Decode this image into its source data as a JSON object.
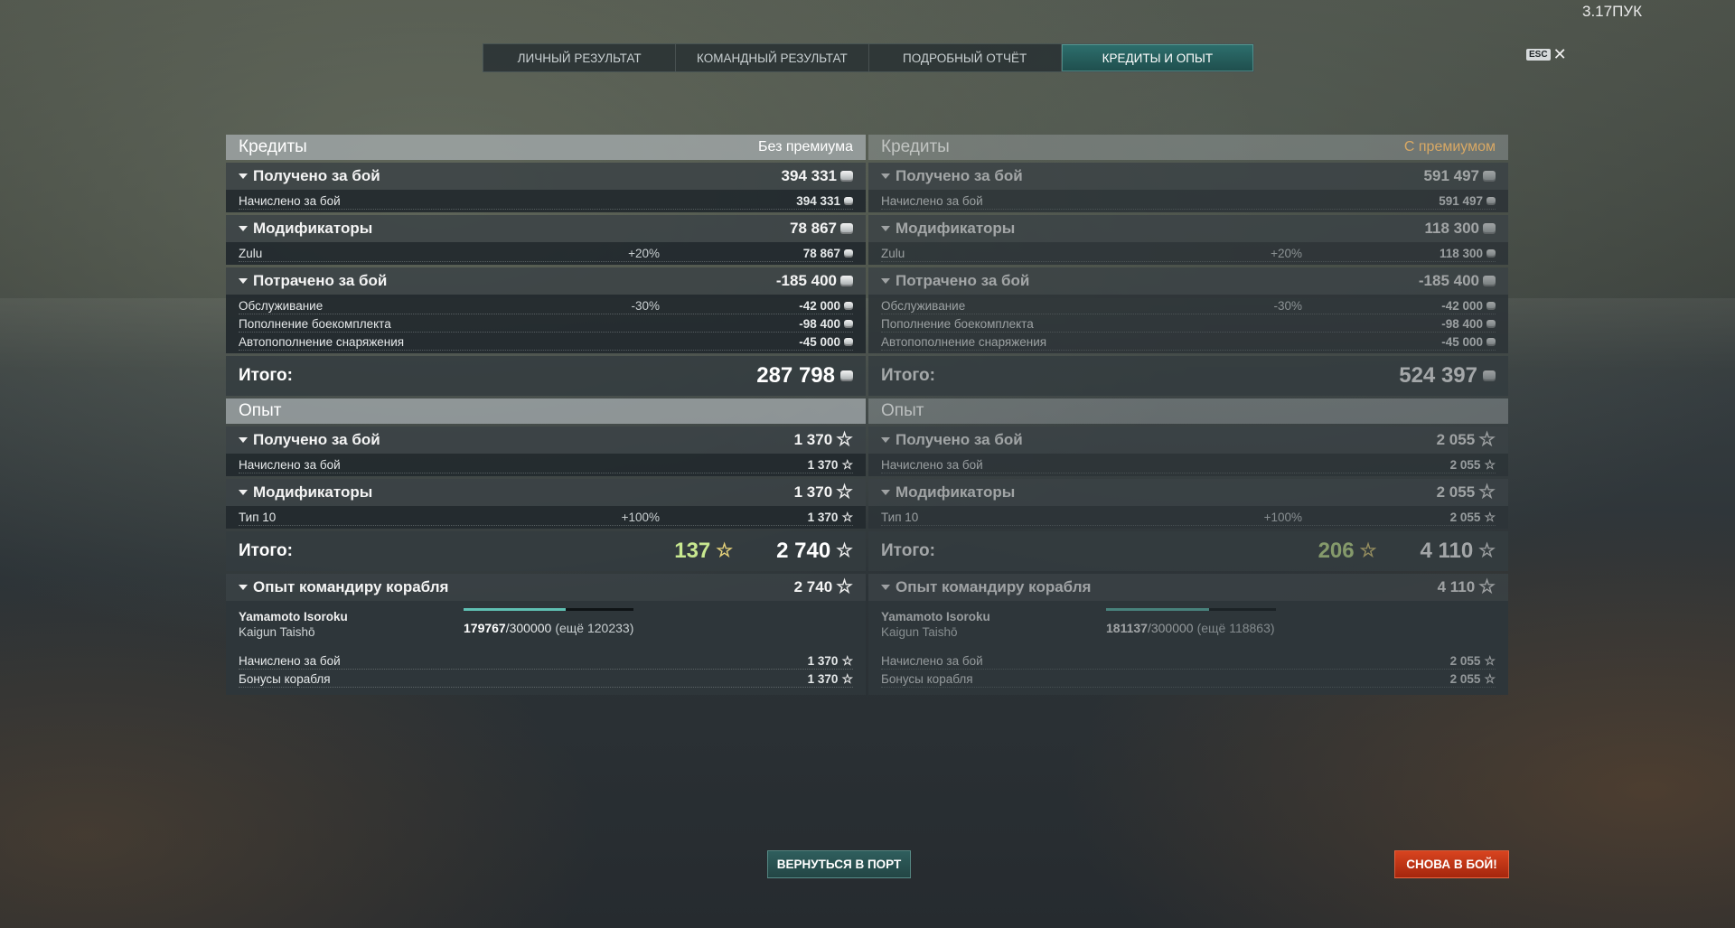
{
  "version": "3.17ПУК",
  "tabs": [
    "ЛИЧНЫЙ РЕЗУЛЬТАТ",
    "КОМАНДНЫЙ РЕЗУЛЬТАТ",
    "ПОДРОБНЫЙ ОТЧЁТ",
    "КРЕДИТЫ И ОПЫТ"
  ],
  "active_tab": "КРЕДИТЫ И ОПЫТ",
  "esc": {
    "key": "ESC",
    "close": "✕"
  },
  "icons": {
    "credit": "credit-coin-icon",
    "xp": "star-xp-icon",
    "collapse": "triangle-down-icon"
  },
  "colors": {
    "premium_label": "#d8a864",
    "free_xp": "#c8e890",
    "tab_active": "#2d6f6d",
    "battle_button": "#d8441f"
  },
  "left": {
    "credits_header": "Кредиты",
    "credits_note": "Без премиума",
    "earned": {
      "label": "Получено за бой",
      "value": "394 331",
      "rows": [
        {
          "name": "Начислено за бой",
          "value": "394 331"
        }
      ]
    },
    "modifiers": {
      "label": "Модификаторы",
      "value": "78 867",
      "rows": [
        {
          "name": "Zulu",
          "pct": "+20%",
          "value": "78 867"
        }
      ]
    },
    "spent": {
      "label": "Потрачено за бой",
      "value": "-185 400",
      "rows": [
        {
          "name": "Обслуживание",
          "pct": "-30%",
          "value": "-42 000"
        },
        {
          "name": "Пополнение боекомплекта",
          "pct": "",
          "value": "-98 400"
        },
        {
          "name": "Автопополнение снаряжения",
          "pct": "",
          "value": "-45 000"
        }
      ]
    },
    "credits_total": {
      "label": "Итого:",
      "value": "287 798"
    },
    "xp_header": "Опыт",
    "xp_earned": {
      "label": "Получено за бой",
      "value": "1 370",
      "rows": [
        {
          "name": "Начислено за бой",
          "value": "1 370"
        }
      ]
    },
    "xp_modifiers": {
      "label": "Модификаторы",
      "value": "1 370",
      "rows": [
        {
          "name": "Тип 10",
          "pct": "+100%",
          "value": "1 370"
        }
      ]
    },
    "xp_total": {
      "label": "Итого:",
      "free": "137",
      "value": "2 740"
    },
    "commander": {
      "label": "Опыт командиру корабля",
      "value": "2 740",
      "name": "Yamamoto Isoroku",
      "rank": "Kaigun Taishō",
      "xp_current": "179767",
      "xp_max": "/300000",
      "xp_left": "(ещё 120233)",
      "progress": 0.599,
      "rows": [
        {
          "name": "Начислено за бой",
          "value": "1 370"
        },
        {
          "name": "Бонусы корабля",
          "value": "1 370"
        }
      ]
    }
  },
  "right": {
    "credits_header": "Кредиты",
    "credits_note": "С премиумом",
    "earned": {
      "label": "Получено за бой",
      "value": "591 497",
      "rows": [
        {
          "name": "Начислено за бой",
          "value": "591 497"
        }
      ]
    },
    "modifiers": {
      "label": "Модификаторы",
      "value": "118 300",
      "rows": [
        {
          "name": "Zulu",
          "pct": "+20%",
          "value": "118 300"
        }
      ]
    },
    "spent": {
      "label": "Потрачено за бой",
      "value": "-185 400",
      "rows": [
        {
          "name": "Обслуживание",
          "pct": "-30%",
          "value": "-42 000"
        },
        {
          "name": "Пополнение боекомплекта",
          "pct": "",
          "value": "-98 400"
        },
        {
          "name": "Автопополнение снаряжения",
          "pct": "",
          "value": "-45 000"
        }
      ]
    },
    "credits_total": {
      "label": "Итого:",
      "value": "524 397"
    },
    "xp_header": "Опыт",
    "xp_earned": {
      "label": "Получено за бой",
      "value": "2 055",
      "rows": [
        {
          "name": "Начислено за бой",
          "value": "2 055"
        }
      ]
    },
    "xp_modifiers": {
      "label": "Модификаторы",
      "value": "2 055",
      "rows": [
        {
          "name": "Тип 10",
          "pct": "+100%",
          "value": "2 055"
        }
      ]
    },
    "xp_total": {
      "label": "Итого:",
      "free": "206",
      "value": "4 110"
    },
    "commander": {
      "label": "Опыт командиру корабля",
      "value": "4 110",
      "name": "Yamamoto Isoroku",
      "rank": "Kaigun Taishō",
      "xp_current": "181137",
      "xp_max": "/300000",
      "xp_left": "(ещё 118863)",
      "progress": 0.604,
      "rows": [
        {
          "name": "Начислено за бой",
          "value": "2 055"
        },
        {
          "name": "Бонусы корабля",
          "value": "2 055"
        }
      ]
    }
  },
  "buttons": {
    "port": "ВЕРНУТЬСЯ В ПОРТ",
    "battle": "СНОВА В БОЙ!"
  }
}
